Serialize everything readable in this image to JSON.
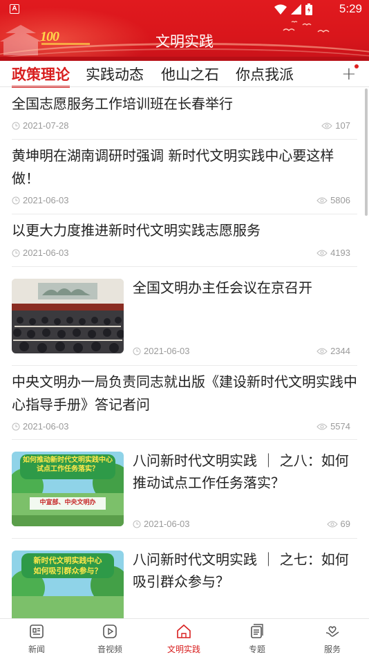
{
  "status_bar": {
    "time": "5:29",
    "notification_icon": "A"
  },
  "header": {
    "title": "文明实践",
    "logo_text": "100"
  },
  "tabs": [
    {
      "label": "政策理论",
      "active": true
    },
    {
      "label": "实践动态",
      "active": false
    },
    {
      "label": "他山之石",
      "active": false
    },
    {
      "label": "你点我派",
      "active": false
    }
  ],
  "tabs_add_label": "+",
  "articles": [
    {
      "title": "全国志愿服务工作培训班在长春举行",
      "date": "2021-07-28",
      "views": "107"
    },
    {
      "title": "黄坤明在湖南调研时强调 新时代文明实践中心要这样做！",
      "date": "2021-06-03",
      "views": "5806"
    },
    {
      "title": "以更大力度推进新时代文明实践志愿服务",
      "date": "2021-06-03",
      "views": "4193"
    },
    {
      "title": "全国文明办主任会议在京召开",
      "date": "2021-06-03",
      "views": "2344",
      "thumbnail": "meeting-photo"
    },
    {
      "title": "中央文明办一局负责同志就出版《建设新时代文明实践中心指导手册》答记者问",
      "date": "2021-06-03",
      "views": "5574"
    },
    {
      "title": "八问新时代文明实践 ｜ 之八：如何推动试点工作任务落实？",
      "date": "2021-06-03",
      "views": "69",
      "thumbnail_text": {
        "line1": "如何推动新时代文明实践中心",
        "line2": "试点工作任务落实？",
        "footer": "中宣部、中央文明办"
      }
    },
    {
      "title": "八问新时代文明实践 ｜ 之七：如何吸引群众参与？",
      "date": "",
      "views": "",
      "thumbnail_text": {
        "line1": "新时代文明实践中心",
        "line2": "如何吸引群众参与？"
      }
    }
  ],
  "bottom_nav": [
    {
      "label": "新闻",
      "icon": "news-icon",
      "active": false
    },
    {
      "label": "音视频",
      "icon": "video-icon",
      "active": false
    },
    {
      "label": "文明实践",
      "icon": "home-icon",
      "active": true
    },
    {
      "label": "专题",
      "icon": "topic-icon",
      "active": false
    },
    {
      "label": "服务",
      "icon": "service-icon",
      "active": false
    }
  ],
  "colors": {
    "accent": "#d81e1e",
    "header": "#e11a1f",
    "meta": "#9a9a9a"
  }
}
